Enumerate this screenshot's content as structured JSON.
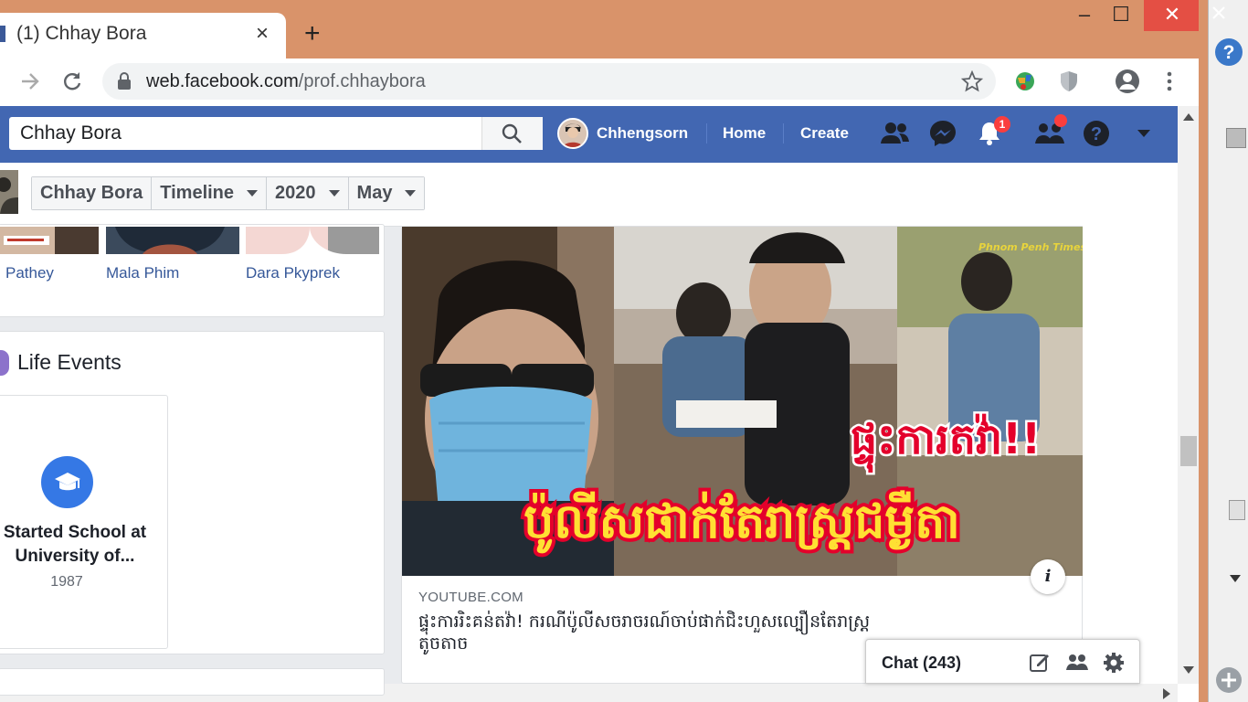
{
  "browser": {
    "tab_title": "(1) Chhay Bora",
    "tab_close": "×",
    "new_tab": "+",
    "url_host": "web.facebook.com",
    "url_path": "/prof.chhaybora",
    "window_controls": {
      "minimize": "–",
      "maximize": "☐",
      "close": "✕"
    }
  },
  "facebook": {
    "search_value": "Chhay Bora",
    "profile_name": "Chhengsorn",
    "nav_home": "Home",
    "nav_create": "Create",
    "notification_count": "1",
    "breadcrumb": [
      "Chhay Bora",
      "Timeline",
      "2020",
      "May"
    ],
    "friends": [
      "Pathey",
      "Mala Phim",
      "Dara Pkyprek"
    ],
    "life_events_title": "Life Events",
    "life_event": {
      "title_line1": "Started School at",
      "title_line2": "University of...",
      "year": "1987"
    },
    "post": {
      "source": "YOUTUBE.COM",
      "title_line1": "ផ្ទុះការរិះគន់តវ៉ា! ករណីប៉ូលីសចរាចរណ៍ចាប់ផាក់ជិះហួសល្បឿនតែរាស្ត្រ",
      "title_line2": "តូចតាច",
      "overlay_line1": "ផ្ទុះការតវ៉ា!!",
      "overlay_line2": "ប៉ូលីសផាក់តែរាស្ត្រជម្ងឺតា",
      "watermark": "Phnom Penh Times",
      "info_icon": "i"
    },
    "chat_label": "Chat (243)"
  },
  "colors": {
    "fb_blue": "#4267b2",
    "chrome_frame": "#d9936a",
    "close_red": "#e44f44",
    "overlay_yellow": "#ffe033",
    "overlay_red": "#e4002b"
  }
}
